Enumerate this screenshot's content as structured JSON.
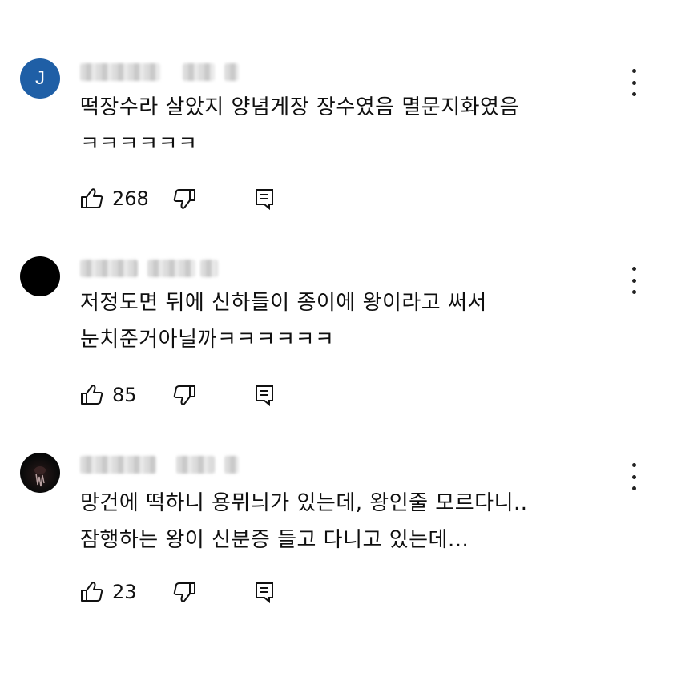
{
  "comments": [
    {
      "avatar_letter": "J",
      "avatar_color": "#1f5fa6",
      "text_lines": [
        "떡장수라 살았지 양념게장 장수였음 멸문지화였음",
        "ㅋㅋㅋㅋㅋㅋ"
      ],
      "like_count": "268"
    },
    {
      "avatar_letter": "",
      "avatar_color": "#000000",
      "text_lines": [
        "저정도면 뒤에 신하들이 종이에 왕이라고 써서",
        "눈치준거아닐까ㅋㅋㅋㅋㅋㅋ"
      ],
      "like_count": "85"
    },
    {
      "avatar_letter": "",
      "avatar_color": "#000000",
      "text_lines": [
        "망건에 떡하니 용뮈늬가 있는데, 왕인줄 모르다니..",
        "잠행하는 왕이 신분증 들고 다니고 있는데..."
      ],
      "like_count": "23"
    }
  ],
  "icons": {
    "like": "thumbs-up-icon",
    "dislike": "thumbs-down-icon",
    "reply": "reply-icon",
    "menu": "more-vert-icon"
  }
}
